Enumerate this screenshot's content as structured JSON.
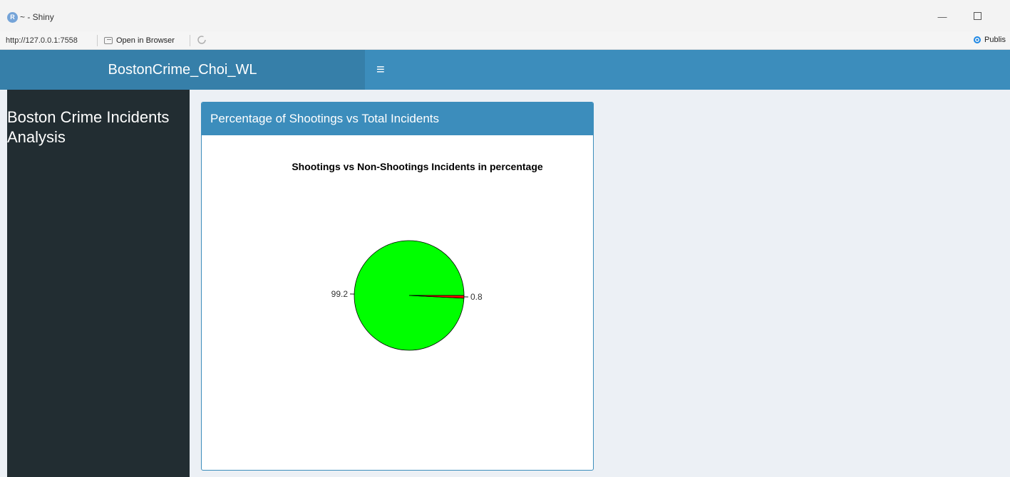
{
  "window": {
    "title": "~ - Shiny",
    "app_icon_letter": "R",
    "minimize_symbol": "—"
  },
  "toolbar": {
    "url": "http://127.0.0.1:7558",
    "open_in_browser": "Open in Browser",
    "publish": "Publis"
  },
  "header": {
    "logo": "BostonCrime_Choi_WL",
    "menu_symbol": "≡"
  },
  "sidebar": {
    "title": "Boston Crime Incidents Analysis"
  },
  "box": {
    "title": "Percentage of Shootings vs Total Incidents"
  },
  "chart_data": {
    "type": "pie",
    "title": "Shootings vs Non-Shootings Incidents in percentage",
    "slices": [
      {
        "label": "99.2",
        "value": 99.2,
        "color": "#00ff00"
      },
      {
        "label": "0.8",
        "value": 0.8,
        "color": "#ff0000"
      }
    ],
    "start_angle_deg": 0,
    "direction": "counterclockwise"
  }
}
